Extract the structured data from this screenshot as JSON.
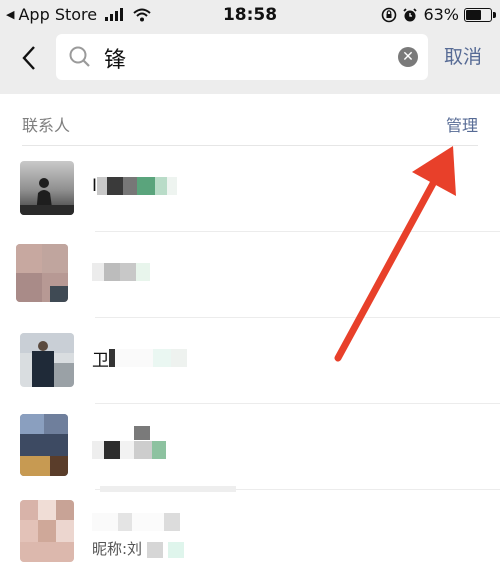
{
  "status_bar": {
    "carrier": "App Store",
    "time": "18:58",
    "battery_percent": "63%",
    "battery_level": 0.63,
    "icons": [
      "back-triangle-icon",
      "signal-icon",
      "wifi-icon",
      "orientation-lock-icon",
      "alarm-icon",
      "battery-icon"
    ]
  },
  "search": {
    "query": "锋",
    "cancel_label": "取消",
    "icons": [
      "back-chevron-icon",
      "search-icon",
      "clear-icon"
    ]
  },
  "section": {
    "title": "联系人",
    "action_label": "管理"
  },
  "contacts": [
    {
      "name_prefix": "Ⅰ",
      "nickname": ""
    },
    {
      "name_prefix": "",
      "nickname": ""
    },
    {
      "name_prefix": "卫",
      "nickname": ""
    },
    {
      "name_prefix": "",
      "nickname": ""
    },
    {
      "name_prefix": "",
      "nickname": "昵称:刘"
    }
  ],
  "colors": {
    "link": "#576b95",
    "background": "#ededed",
    "arrow": "#e8402a"
  }
}
